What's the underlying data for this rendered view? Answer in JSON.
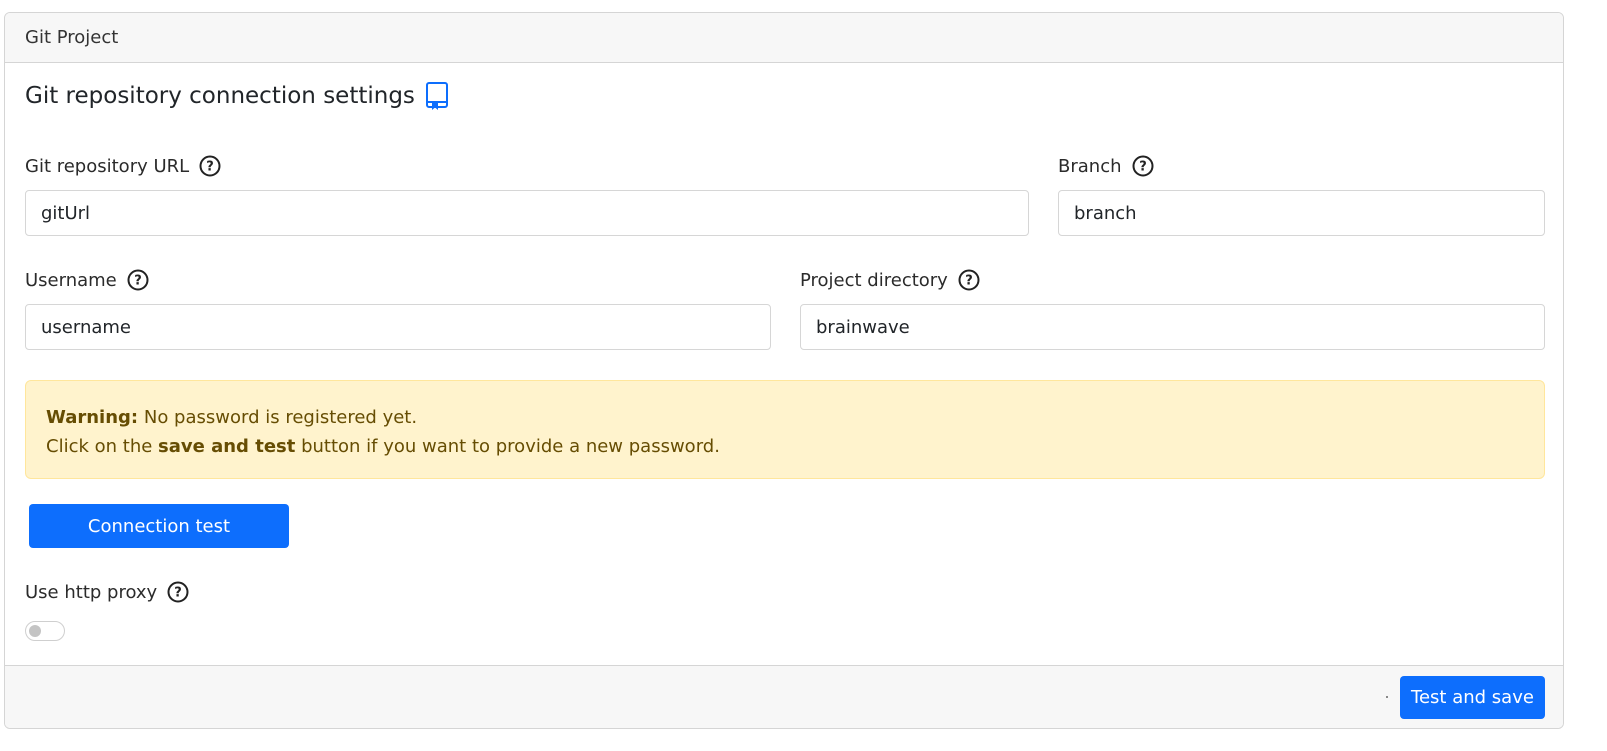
{
  "panel": {
    "title": "Git Project"
  },
  "section": {
    "title": "Git repository connection settings",
    "icon": "book-icon"
  },
  "fields": {
    "git_url": {
      "label": "Git repository URL",
      "value": "gitUrl"
    },
    "branch": {
      "label": "Branch",
      "value": "branch"
    },
    "username": {
      "label": "Username",
      "value": "username"
    },
    "project_directory": {
      "label": "Project directory",
      "value": "brainwave"
    }
  },
  "warning": {
    "prefix": "Warning:",
    "line1": "No password is registered yet.",
    "line2_before": "Click on the",
    "line2_bold": "save and test",
    "line2_after": "button if you want to provide a new password."
  },
  "buttons": {
    "connection_test": "Connection test",
    "test_and_save": "Test and save"
  },
  "proxy": {
    "label": "Use http proxy",
    "enabled": false
  },
  "colors": {
    "primary": "#0d6efd",
    "warning_bg": "#fff3cd",
    "warning_text": "#664d03"
  }
}
